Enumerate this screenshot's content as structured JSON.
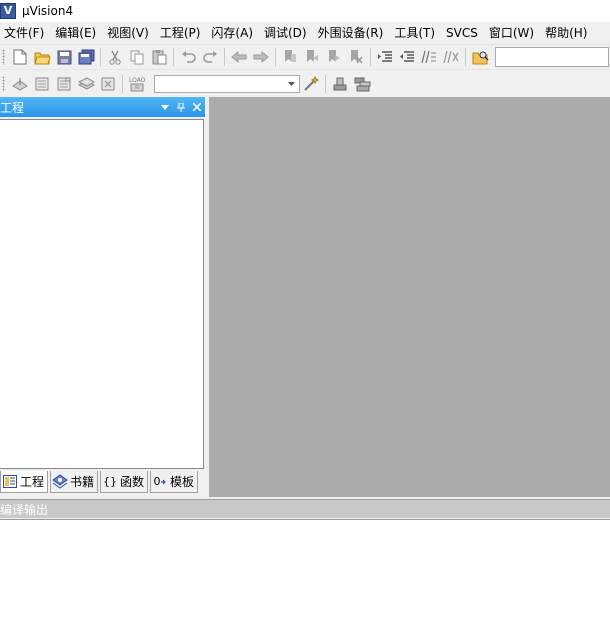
{
  "window": {
    "title": "µVision4",
    "app_icon": "uv-icon"
  },
  "menu": [
    {
      "label": "文件(F)"
    },
    {
      "label": "编辑(E)"
    },
    {
      "label": "视图(V)"
    },
    {
      "label": "工程(P)"
    },
    {
      "label": "闪存(A)"
    },
    {
      "label": "调试(D)"
    },
    {
      "label": "外围设备(R)"
    },
    {
      "label": "工具(T)"
    },
    {
      "label": "SVCS"
    },
    {
      "label": "窗口(W)"
    },
    {
      "label": "帮助(H)"
    }
  ],
  "toolbar1_icons": [
    "new-file-icon",
    "open-folder-icon",
    "save-icon",
    "save-all-icon",
    "cut-icon",
    "copy-icon",
    "paste-icon",
    "undo-icon",
    "redo-icon",
    "nav-back-icon",
    "nav-forward-icon",
    "bookmark-icon",
    "bookmark-prev-icon",
    "bookmark-next-icon",
    "bookmark-clear-icon",
    "indent-icon",
    "unindent-icon",
    "comment-icon",
    "uncomment-icon",
    "find-in-files-icon"
  ],
  "toolbar2_icons": [
    "translate-icon",
    "build-icon",
    "rebuild-icon",
    "batch-build-icon",
    "stop-build-icon",
    "download-icon",
    "target-options-icon",
    "manage-components-icon",
    "books-icon"
  ],
  "download_label": "LOAD",
  "search": {
    "value": ""
  },
  "target": {
    "value": ""
  },
  "project_panel": {
    "title": "工程",
    "tabs": [
      {
        "label": "工程",
        "icon": "project-tab-icon",
        "active": true
      },
      {
        "label": "书籍",
        "icon": "books-tab-icon",
        "active": false
      },
      {
        "label": "函数",
        "icon": "functions-tab-icon",
        "glyph": "{}",
        "active": false
      },
      {
        "label": "模板",
        "icon": "templates-tab-icon",
        "glyph": "0",
        "active": false
      }
    ]
  },
  "output_panel": {
    "title": "编译输出"
  },
  "colors": {
    "panel_header": "#3aa2ee",
    "workspace": "#ababab"
  }
}
